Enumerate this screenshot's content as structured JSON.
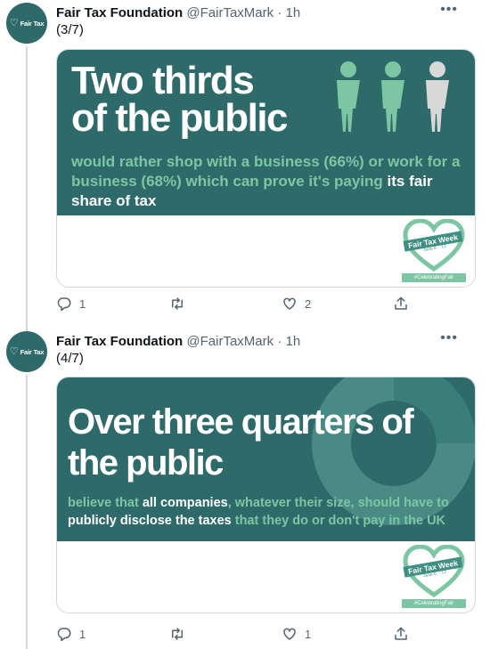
{
  "account": {
    "name": "Fair Tax Foundation",
    "handle": "@FairTaxMark",
    "dot": "·",
    "avatar_text": "Fair Tax",
    "more": "•••"
  },
  "tweets": [
    {
      "time": "1h",
      "text": "(3/7)",
      "image": {
        "headline_lines": [
          "Two thirds",
          "of the public"
        ],
        "sub_green": "would rather shop with a business (66%) or work for a business (68%) which can prove it's paying ",
        "sub_white": "its fair share of tax",
        "badge_title": "Fair Tax Week",
        "badge_date": "June 6 – 12",
        "badge_tag": "#CelebratingFair"
      },
      "stats": {
        "replies": "1",
        "retweets": "",
        "likes": "2"
      }
    },
    {
      "time": "1h",
      "text": "(4/7)",
      "image": {
        "headline_lines": [
          "Over three quarters of",
          "the public"
        ],
        "sub_parts": [
          "believe that ",
          "all companies",
          ", whatever their size, should have to ",
          "publicly disclose the taxes",
          " that they do or don't pay in the UK"
        ],
        "badge_title": "Fair Tax Week",
        "badge_date": "June 6 – 12",
        "badge_tag": "#CelebratingFair"
      },
      "stats": {
        "replies": "1",
        "retweets": "",
        "likes": "1"
      }
    }
  ],
  "colors": {
    "brand_teal": "#2f6a6b",
    "accent_green": "#7cc6a3",
    "text_secondary": "#536471"
  },
  "icons": [
    "heart-logo-icon",
    "more-icon",
    "reply-icon",
    "retweet-icon",
    "like-icon",
    "share-icon",
    "person-icon",
    "donut-chart-icon"
  ]
}
